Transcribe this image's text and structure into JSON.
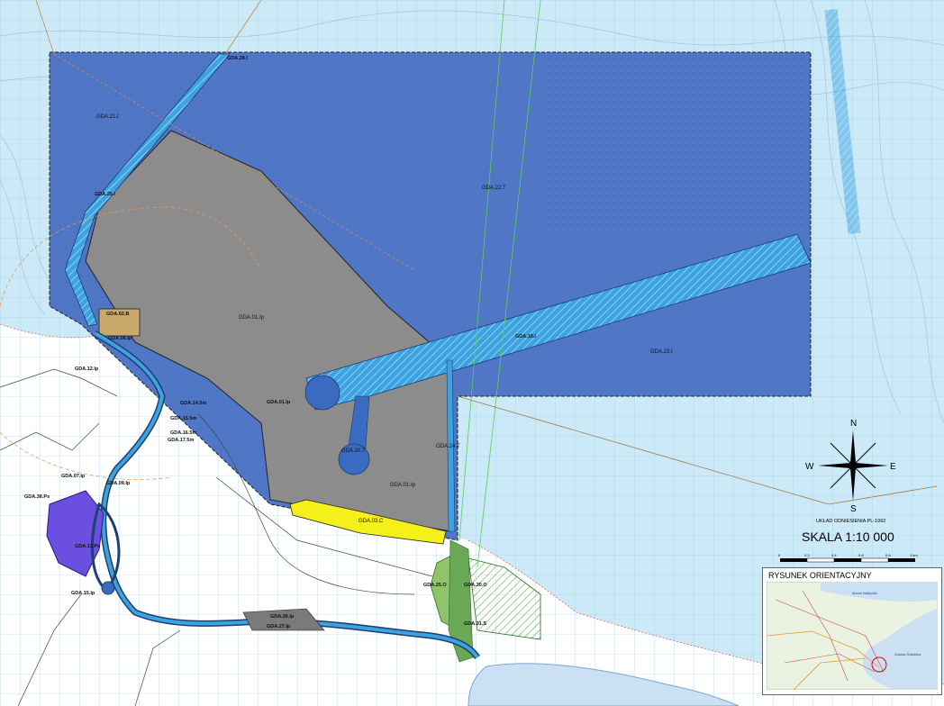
{
  "map": {
    "zones": [
      {
        "id": "z1",
        "label": "GDA.21.I"
      },
      {
        "id": "z2",
        "label": "GDA.22.T"
      },
      {
        "id": "z3",
        "label": "GDA.23.I"
      },
      {
        "id": "z4",
        "label": "GDA.01.Ip"
      },
      {
        "id": "z5",
        "label": "GDA.01.Ip"
      },
      {
        "id": "z6",
        "label": "GDA.20.T"
      },
      {
        "id": "z7",
        "label": "GDA.24.T"
      },
      {
        "id": "z8",
        "label": "GDA.03.C"
      },
      {
        "id": "z9",
        "label": "GDA.02.B"
      },
      {
        "id": "z10",
        "label": "GDA.25.O"
      },
      {
        "id": "z11",
        "label": "GDA.30.O"
      },
      {
        "id": "z12",
        "label": "GDA.13.Ps"
      },
      {
        "id": "z13",
        "label": "GDA.36.Ps"
      },
      {
        "id": "z14",
        "label": "GDA.12.Ip"
      },
      {
        "id": "z15",
        "label": "GDA.07.Ip"
      },
      {
        "id": "z16",
        "label": "GDA.09.Ip"
      },
      {
        "id": "z17",
        "label": "GDA.15.Ip"
      },
      {
        "id": "z18",
        "label": "GDA.14.5m"
      },
      {
        "id": "z19",
        "label": "GDA.15.5m"
      },
      {
        "id": "z20",
        "label": "GDA.16.5m"
      },
      {
        "id": "z21",
        "label": "GDA.17.5m"
      },
      {
        "id": "z22",
        "label": "GDA.06.Ip"
      },
      {
        "id": "z23",
        "label": "GDA.26.Ip"
      },
      {
        "id": "z24",
        "label": "GDA.27.Ip"
      },
      {
        "id": "z25",
        "label": "GDA.31.S"
      },
      {
        "id": "z26",
        "label": "GDA.28.I"
      },
      {
        "id": "z27",
        "label": "GDA.25.I"
      },
      {
        "id": "z28",
        "label": "GDA.19.I"
      },
      {
        "id": "z29",
        "label": "GDA.01.Ip"
      }
    ],
    "compass": {
      "n": "N",
      "s": "S",
      "e": "E",
      "w": "W"
    },
    "crs_label": "UKŁAD ODNIESIENIA PL-1992",
    "scale_label": "SKALA 1:10 000",
    "scale_ticks": [
      "0",
      "0.2",
      "0.4",
      "0.6",
      "0.8",
      "1 km"
    ],
    "inset_title": "RYSUNEK ORIENTACYJNY",
    "inset_labels": {
      "sea": "Morze Bałtyckie",
      "bay": "Zatoka Gdańska"
    },
    "colors": {
      "sea": "#cbe9f7",
      "land": "#ffffff",
      "zone_blue": "#4f77c6",
      "zone_grey": "#8c8c8c",
      "channel": "#3da2e0",
      "yellow": "#f5ef1a",
      "green": "#8fc46a"
    }
  }
}
